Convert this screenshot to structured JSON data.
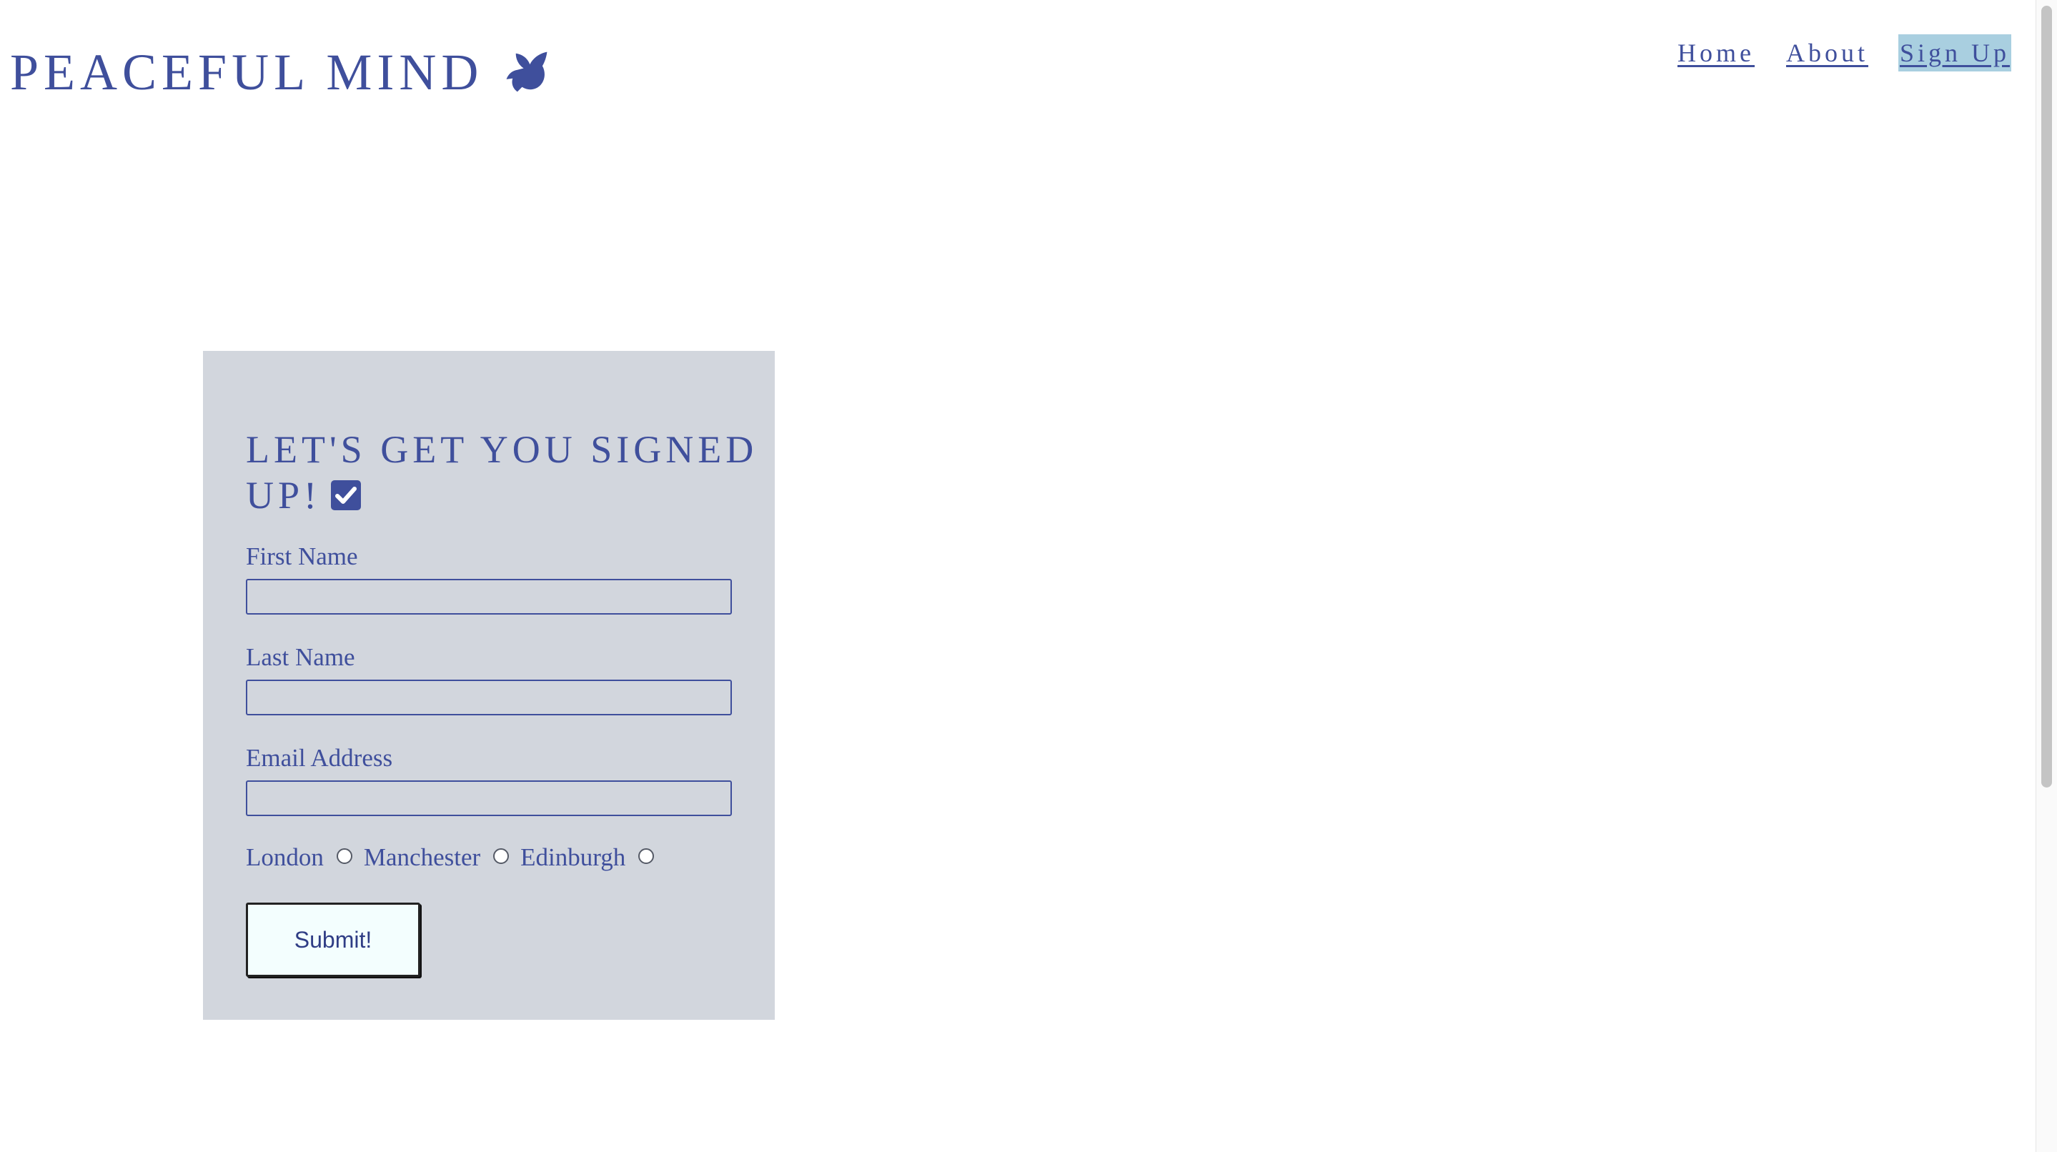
{
  "header": {
    "logo_text": "PEACEFUL MIND",
    "logo_icon": "dove-icon",
    "nav": [
      {
        "label": "Home",
        "active": false
      },
      {
        "label": "About",
        "active": false
      },
      {
        "label": "Sign Up",
        "active": true
      }
    ]
  },
  "form": {
    "title": "LET'S GET YOU SIGNED UP!",
    "title_icon": "check-square-icon",
    "fields": [
      {
        "label": "First Name",
        "value": ""
      },
      {
        "label": "Last Name",
        "value": ""
      },
      {
        "label": "Email Address",
        "value": ""
      }
    ],
    "locations": [
      {
        "label": "London",
        "selected": false
      },
      {
        "label": "Manchester",
        "selected": false
      },
      {
        "label": "Edinburgh",
        "selected": false
      }
    ],
    "submit_label": "Submit!"
  },
  "colors": {
    "brand": "#3f4f9c",
    "card_background": "#d2d6dd",
    "active_nav_highlight": "#a9cfe0",
    "button_background": "#f3fefe"
  }
}
